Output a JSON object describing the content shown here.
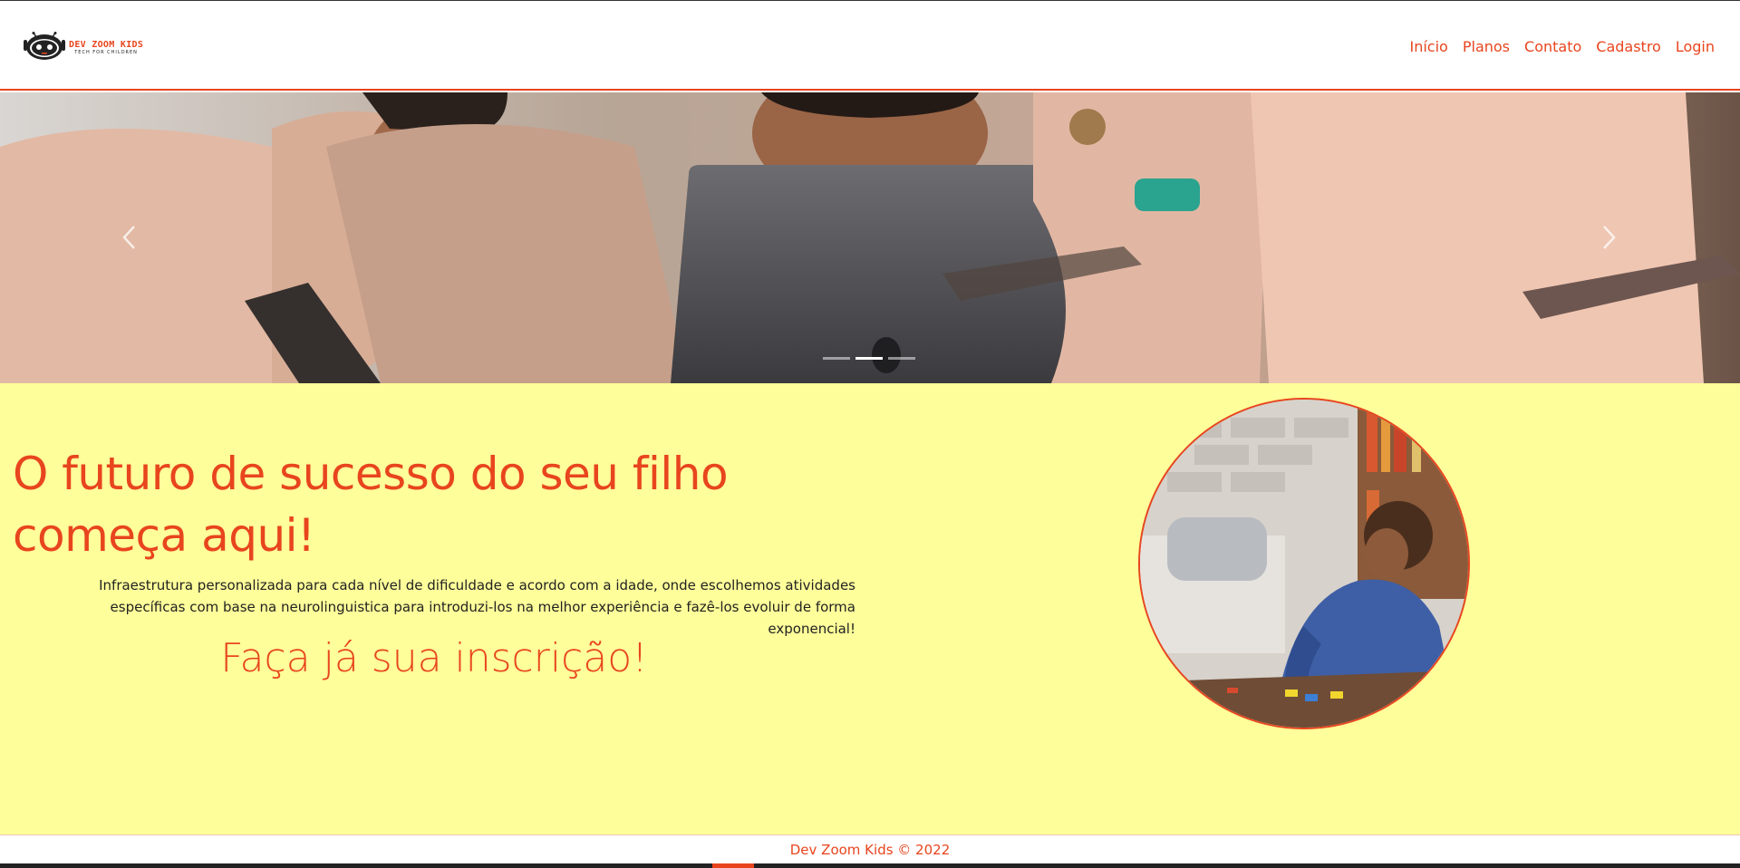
{
  "brand": {
    "name": "DEV ZOOM KIDS",
    "tagline": "TECH FOR CHILDREN",
    "accent_color": "#e8451e",
    "logo_icon": "robot-head-icon"
  },
  "nav": {
    "items": [
      {
        "label": "Início"
      },
      {
        "label": "Planos"
      },
      {
        "label": "Contato"
      },
      {
        "label": "Cadastro"
      },
      {
        "label": "Login"
      }
    ]
  },
  "carousel": {
    "slide_count": 3,
    "active_index": 1,
    "prev_icon": "chevron-left-icon",
    "next_icon": "chevron-right-icon"
  },
  "hero": {
    "background_color": "#fefe9a",
    "title": "O futuro de sucesso do seu filho começa aqui!",
    "description": "Infraestrutura personalizada para cada nível de dificuldade e acordo com a idade, onde escolhemos atividades específicas com base na neurolinguistica para introduzi-los na melhor experiência e fazê-los evoluir de forma exponencial!",
    "cta": "Faça já sua inscrição!"
  },
  "footer": {
    "text": "Dev Zoom Kids © 2022"
  }
}
